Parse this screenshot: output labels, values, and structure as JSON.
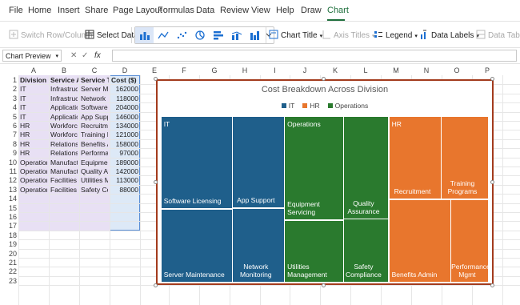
{
  "menu": {
    "items": [
      "File",
      "Home",
      "Insert",
      "Share",
      "Page Layout",
      "Formulas",
      "Data",
      "Review",
      "View",
      "Help",
      "Draw",
      "Chart"
    ],
    "active": "Chart"
  },
  "ribbon": {
    "switch_row_column": "Switch Row/Column",
    "select_data": "Select Data",
    "chart_title": "Chart Title",
    "axis_titles": "Axis Titles",
    "legend": "Legend",
    "data_labels": "Data Labels",
    "data_table": "Data Table"
  },
  "formula_bar": {
    "name_box": "Chart Preview",
    "cancel": "✕",
    "enter": "✓",
    "fx": "fx",
    "value": ""
  },
  "grid": {
    "columns": [
      "A",
      "B",
      "C",
      "D",
      "E",
      "F",
      "G",
      "H",
      "I",
      "J",
      "K",
      "L",
      "M",
      "N",
      "O",
      "P"
    ],
    "rows": [
      "1",
      "2",
      "3",
      "4",
      "5",
      "6",
      "7",
      "8",
      "9",
      "10",
      "11",
      "12",
      "13",
      "14",
      "15",
      "16",
      "17",
      "18",
      "19",
      "20",
      "21",
      "22",
      "23"
    ],
    "headers": [
      "Division",
      "Service An",
      "Service Typ",
      "Cost ($)"
    ],
    "data": [
      [
        "IT",
        "Infrastruct",
        "Server Mai",
        "162000"
      ],
      [
        "IT",
        "Infrastruct",
        "Network M",
        "118000"
      ],
      [
        "IT",
        "Application",
        "Software Li",
        "204000"
      ],
      [
        "IT",
        "Application",
        "App Suppo",
        "146000"
      ],
      [
        "HR",
        "Workforce",
        "Recruitme",
        "134000"
      ],
      [
        "HR",
        "Workforce",
        "Training Pr",
        "121000"
      ],
      [
        "HR",
        "Relations",
        "Benefits Ac",
        "158000"
      ],
      [
        "HR",
        "Relations",
        "Performan",
        "97000"
      ],
      [
        "Operation",
        "Manufactu",
        "Equipment",
        "189000"
      ],
      [
        "Operation",
        "Manufactu",
        "Quality As",
        "142000"
      ],
      [
        "Operation",
        "Facilities",
        "Utilities M",
        "113000"
      ],
      [
        "Operation",
        "Facilities",
        "Safety Cor",
        "88000"
      ]
    ]
  },
  "chart_data": {
    "type": "treemap",
    "title": "Cost Breakdown Across Division",
    "legend": [
      {
        "name": "IT",
        "color": "#1f5f8b"
      },
      {
        "name": "HR",
        "color": "#e8762d"
      },
      {
        "name": "Operations",
        "color": "#2a7a2e"
      }
    ],
    "groups": [
      {
        "name": "IT",
        "color": "#1f5f8b",
        "items": [
          {
            "label": "Software Licensing",
            "value": 204000
          },
          {
            "label": "App Support",
            "value": 146000
          },
          {
            "label": "Server Maintenance",
            "value": 162000
          },
          {
            "label": "Network Monitoring",
            "value": 118000
          }
        ]
      },
      {
        "name": "Operations",
        "color": "#2a7a2e",
        "items": [
          {
            "label": "Equipment Servicing",
            "value": 189000
          },
          {
            "label": "Quality Assurance",
            "value": 142000
          },
          {
            "label": "Utilities Management",
            "value": 113000
          },
          {
            "label": "Safety Compliance",
            "value": 88000
          }
        ]
      },
      {
        "name": "HR",
        "color": "#e8762d",
        "items": [
          {
            "label": "Recruitment",
            "value": 134000
          },
          {
            "label": "Training Programs",
            "value": 121000
          },
          {
            "label": "Benefits Admin",
            "value": 158000
          },
          {
            "label": "Performance Mgmt",
            "value": 97000
          }
        ]
      }
    ]
  }
}
